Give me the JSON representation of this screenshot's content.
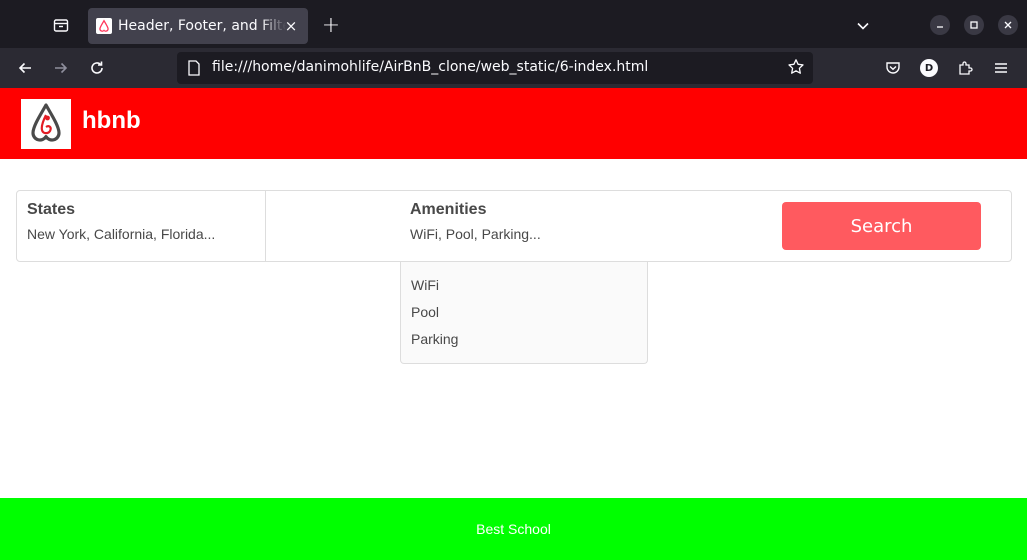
{
  "browser": {
    "tab": {
      "title": "Header, Footer, and Filters",
      "favicon": "airbnb-logo-icon"
    },
    "new_tab_label": "+",
    "close_label": "×",
    "url": "file:///home/danimohlife/AirBnB_clone/web_static/6-index.html",
    "profile_initial": "D"
  },
  "header": {
    "brand": "hbnb",
    "logo": "airbnb-logo-icon",
    "color": "#ff0000"
  },
  "filters": {
    "locations": {
      "title": "States",
      "summary": "New York, California, Florida..."
    },
    "amenities": {
      "title": "Amenities",
      "summary": "WiFi, Pool, Parking..."
    },
    "search_label": "Search",
    "search_color": "#ff5a5f",
    "amenity_options": [
      "WiFi",
      "Pool",
      "Parking"
    ]
  },
  "footer": {
    "text": "Best School",
    "color": "#00ff00"
  }
}
